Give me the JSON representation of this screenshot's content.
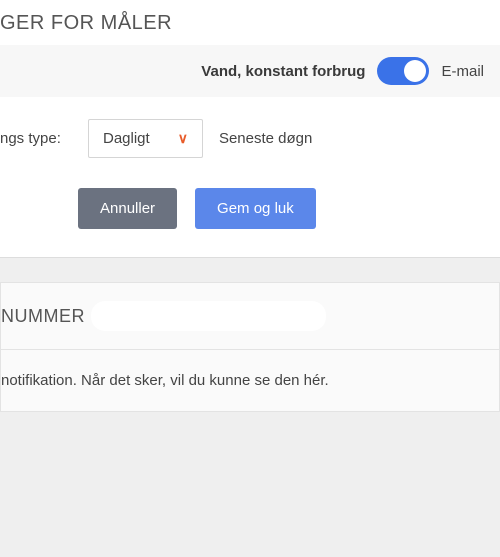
{
  "modal": {
    "title": "GER FOR MÅLER",
    "setting": {
      "label": "Vand, konstant forbrug",
      "toggle_on": true,
      "channel": "E-mail"
    },
    "type": {
      "label": "ngs type:",
      "selected": "Dagligt",
      "hint": "Seneste døgn"
    },
    "buttons": {
      "cancel": "Annuller",
      "save": "Gem og luk"
    }
  },
  "card": {
    "title": "NUMMER",
    "body": "notifikation. Når det sker, vil du kunne se den hér."
  }
}
